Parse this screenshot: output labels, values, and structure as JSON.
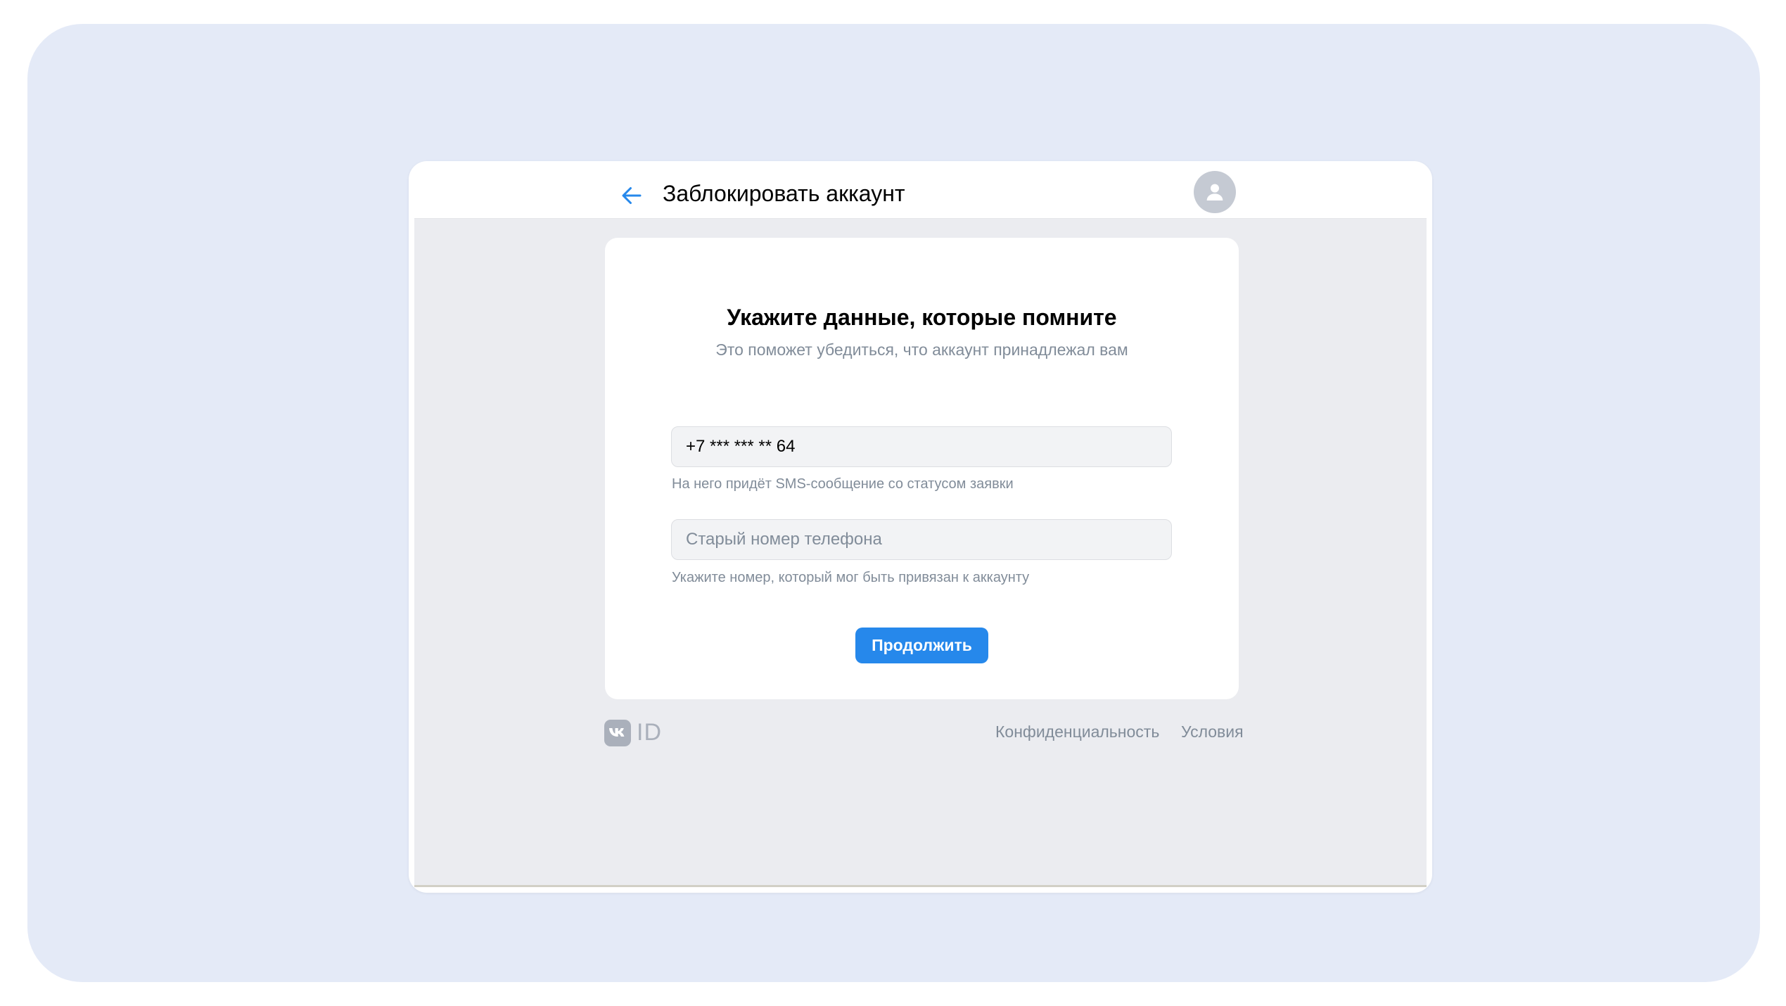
{
  "header": {
    "back_icon": "arrow-left-icon",
    "title": "Заблокировать аккаунт",
    "avatar_icon": "user-avatar-icon"
  },
  "card": {
    "title": "Укажите данные, которые помните",
    "subtitle": "Это поможет убедиться, что аккаунт принадлежал вам",
    "phone_field": {
      "value": "+7 *** *** ** 64",
      "hint": "На него придёт SMS-сообщение со статусом заявки"
    },
    "old_phone_field": {
      "value": "",
      "placeholder": "Старый номер телефона",
      "hint": "Укажите номер, который мог быть привязан к аккаунту"
    },
    "continue_label": "Продолжить"
  },
  "footer": {
    "logo_text": "ID",
    "privacy_label": "Конфиденциальность",
    "terms_label": "Условия"
  },
  "colors": {
    "accent": "#2688eb",
    "outer_background": "#e4eaf7",
    "page_background": "#ebecf0",
    "secondary_text": "#818c99"
  }
}
